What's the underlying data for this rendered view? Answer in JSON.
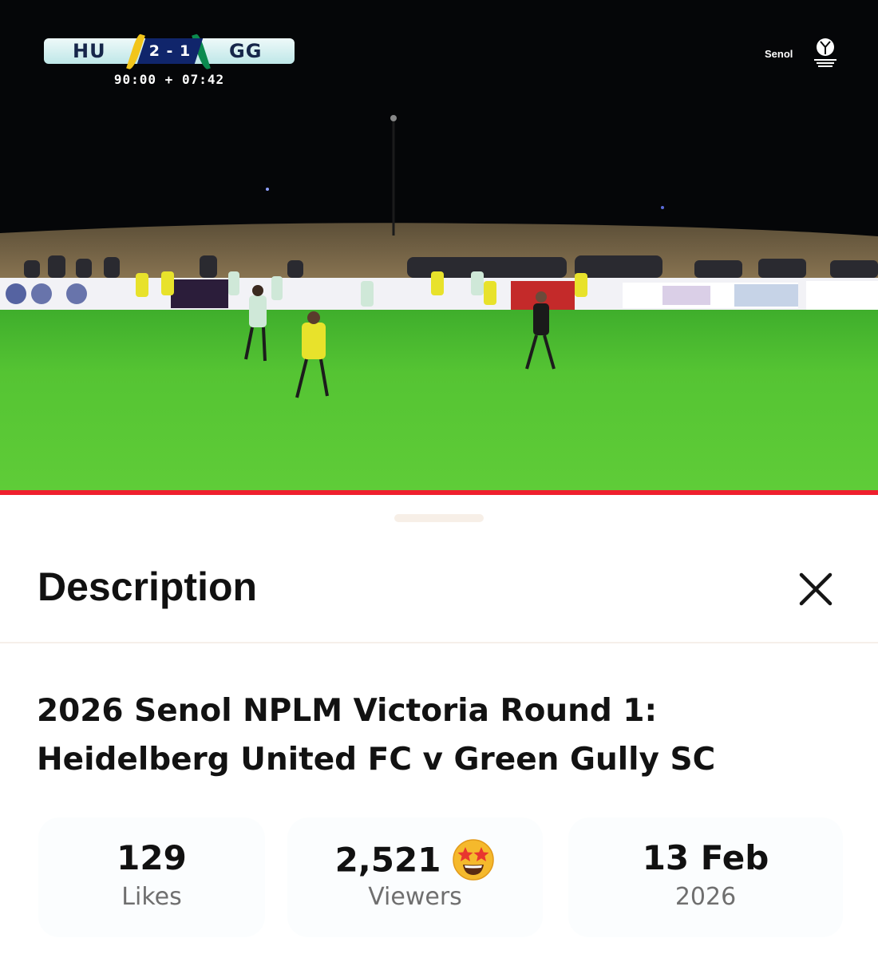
{
  "video": {
    "scorebug": {
      "home": "HU",
      "away": "GG",
      "score": "2 - 1",
      "clock": "90:00 + 07:42"
    },
    "sponsor_text": "Senol",
    "progress_fraction": 1.0,
    "colors": {
      "progress": "#ef1f2d",
      "score_bg": "#10256b",
      "home_accent": "#f2c51a",
      "away_accent": "#0b8a4f"
    }
  },
  "sheet": {
    "title": "Description",
    "close_icon": "close-icon",
    "video_title_line1": "2026 Senol NPLM Victoria Round 1:",
    "video_title_line2": "Heidelberg United FC v Green Gully SC",
    "stats": [
      {
        "value": "129",
        "label": "Likes"
      },
      {
        "value": "2,521",
        "label": "Viewers",
        "icon": "star-struck-emoji-icon"
      },
      {
        "value": "13 Feb",
        "label": "2026"
      }
    ]
  }
}
